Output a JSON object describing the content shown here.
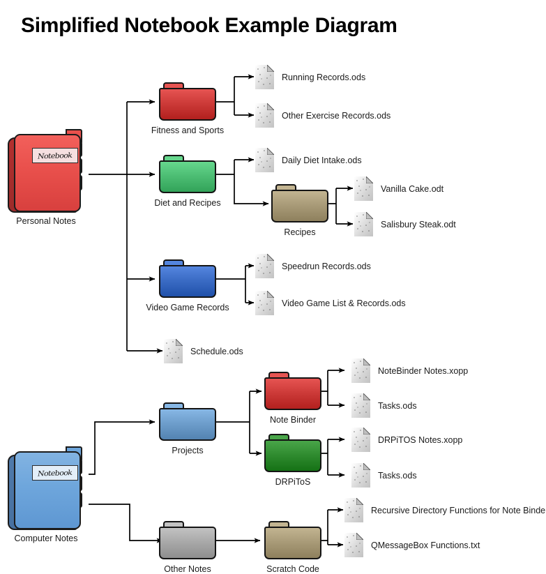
{
  "title": "Simplified Notebook Example Diagram",
  "notebook_label_text": "Notebook",
  "roots": [
    {
      "id": "personal",
      "caption": "Personal Notes",
      "color": "red"
    },
    {
      "id": "computer",
      "caption": "Computer Notes",
      "color": "blue"
    }
  ],
  "folders": [
    {
      "id": "fitness",
      "caption": "Fitness and Sports",
      "color": "#cc3a38"
    },
    {
      "id": "diet",
      "caption": "Diet and Recipes",
      "color": "#4cbd73"
    },
    {
      "id": "recipes",
      "caption": "Recipes",
      "color": "#a89a77"
    },
    {
      "id": "videogame",
      "caption": "Video Game Records",
      "color": "#3a6bc4"
    },
    {
      "id": "projects",
      "caption": "Projects",
      "color": "#6d9dcb"
    },
    {
      "id": "notebinder",
      "caption": "Note Binder",
      "color": "#cc3a38"
    },
    {
      "id": "drpitos",
      "caption": "DRPiToS",
      "color": "#2f8b2f"
    },
    {
      "id": "othernotes",
      "caption": "Other Notes",
      "color": "#a8a8a8"
    },
    {
      "id": "scratch",
      "caption": "Scratch Code",
      "color": "#a89a77"
    }
  ],
  "files": [
    {
      "id": "f-running",
      "label": "Running Records.ods"
    },
    {
      "id": "f-otherex",
      "label": "Other Exercise Records.ods"
    },
    {
      "id": "f-dailydiet",
      "label": "Daily Diet Intake.ods"
    },
    {
      "id": "f-vanilla",
      "label": "Vanilla Cake.odt"
    },
    {
      "id": "f-salisbury",
      "label": "Salisbury Steak.odt"
    },
    {
      "id": "f-speedrun",
      "label": "Speedrun Records.ods"
    },
    {
      "id": "f-vglist",
      "label": "Video Game List & Records.ods"
    },
    {
      "id": "f-schedule",
      "label": "Schedule.ods"
    },
    {
      "id": "f-nbnotes",
      "label": "NoteBinder Notes.xopp"
    },
    {
      "id": "f-nbtasks",
      "label": "Tasks.ods"
    },
    {
      "id": "f-drnotes",
      "label": "DRPiTOS Notes.xopp"
    },
    {
      "id": "f-drtasks",
      "label": "Tasks.ods"
    },
    {
      "id": "f-recursive",
      "label": "Recursive Directory Functions for Note Binder.txt"
    },
    {
      "id": "f-qmsgbox",
      "label": "QMessageBox Functions.txt"
    }
  ],
  "colors": {
    "background": "#ffffff",
    "line": "#000000",
    "text": "#1a1a1a"
  }
}
